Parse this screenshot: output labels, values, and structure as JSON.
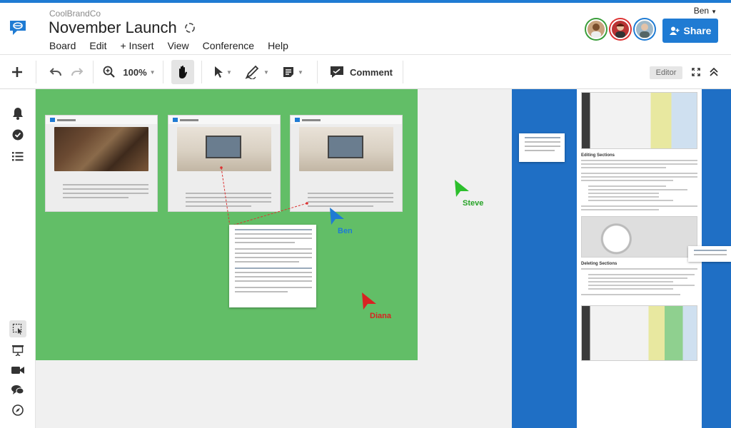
{
  "app": {
    "brand": "CoolBrandCo",
    "title": "November Launch",
    "user": "Ben",
    "share_label": "Share"
  },
  "menu": [
    "Board",
    "Edit",
    "+ Insert",
    "View",
    "Conference",
    "Help"
  ],
  "toolbar": {
    "zoom": "100%",
    "comment_label": "Comment",
    "mode_label": "Editor"
  },
  "canvas": {
    "cursors": [
      {
        "name": "Steve",
        "color": "#2cbf2c"
      },
      {
        "name": "Ben",
        "color": "#1f7bd3"
      },
      {
        "name": "Diana",
        "color": "#d92222"
      }
    ],
    "doc_headings": [
      "Editing Sections",
      "Deleting Sections"
    ]
  },
  "colors": {
    "accent": "#1f7bd3",
    "board_green": "#62be67",
    "board_blue": "#1f6fc5"
  }
}
